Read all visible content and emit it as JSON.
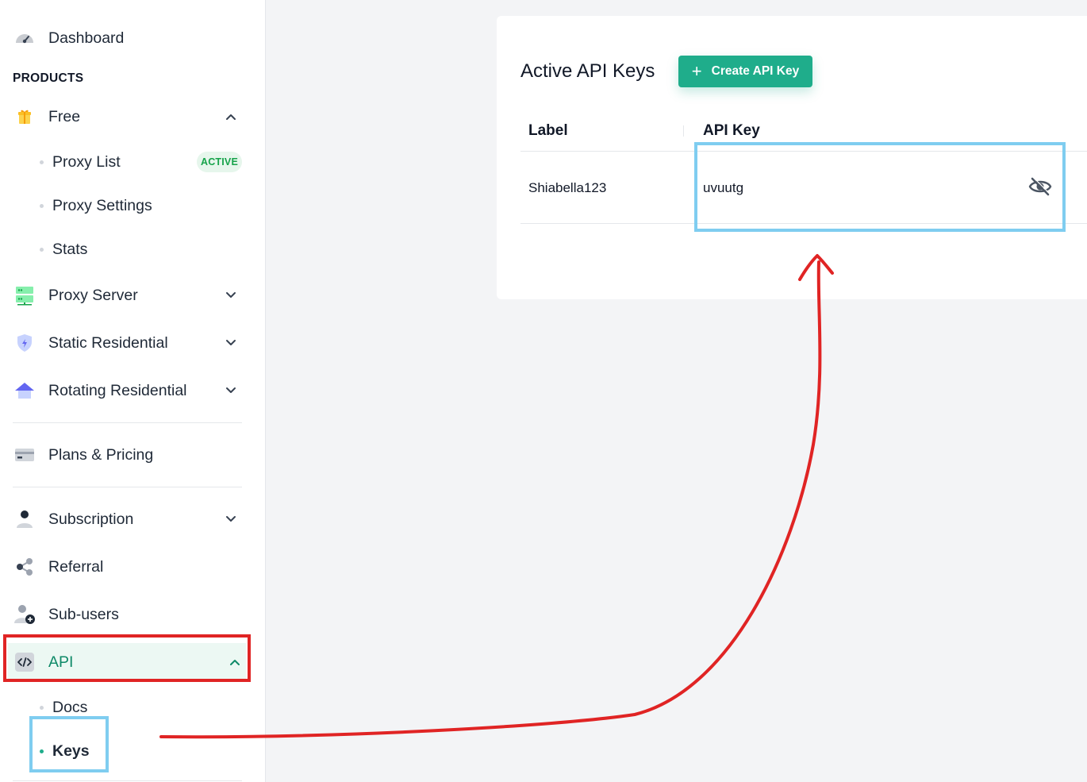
{
  "sidebar": {
    "dashboard": "Dashboard",
    "section_products": "PRODUCTS",
    "free": "Free",
    "free_children": [
      "Proxy List",
      "Proxy Settings",
      "Stats"
    ],
    "active_badge": "ACTIVE",
    "proxy_server": "Proxy Server",
    "static_residential": "Static Residential",
    "rotating_residential": "Rotating Residential",
    "plans_pricing": "Plans & Pricing",
    "subscription": "Subscription",
    "referral": "Referral",
    "sub_users": "Sub-users",
    "api": "API",
    "api_children": [
      "Docs",
      "Keys"
    ],
    "active_item": "Keys"
  },
  "main": {
    "title": "Active API Keys",
    "create_button": "Create API Key",
    "columns": [
      "Label",
      "API Key"
    ],
    "rows": [
      {
        "label": "Shiabella123",
        "api_key": "uvuutg",
        "key_visible": false
      }
    ]
  },
  "colors": {
    "accent": "#1fad8b",
    "active_text": "#0f8a68",
    "annotation_red": "#e02424",
    "annotation_blue": "#7fcdf0"
  },
  "icons": {
    "dashboard": "gauge-icon",
    "free": "gift-icon",
    "proxy_server": "server-icon",
    "static_residential": "shield-icon",
    "rotating_residential": "house-icon",
    "plans_pricing": "credit-card-icon",
    "subscription": "user-icon",
    "referral": "share-icon",
    "sub_users": "add-user-icon",
    "api": "code-icon",
    "toggle_key": "eye-off-icon"
  }
}
